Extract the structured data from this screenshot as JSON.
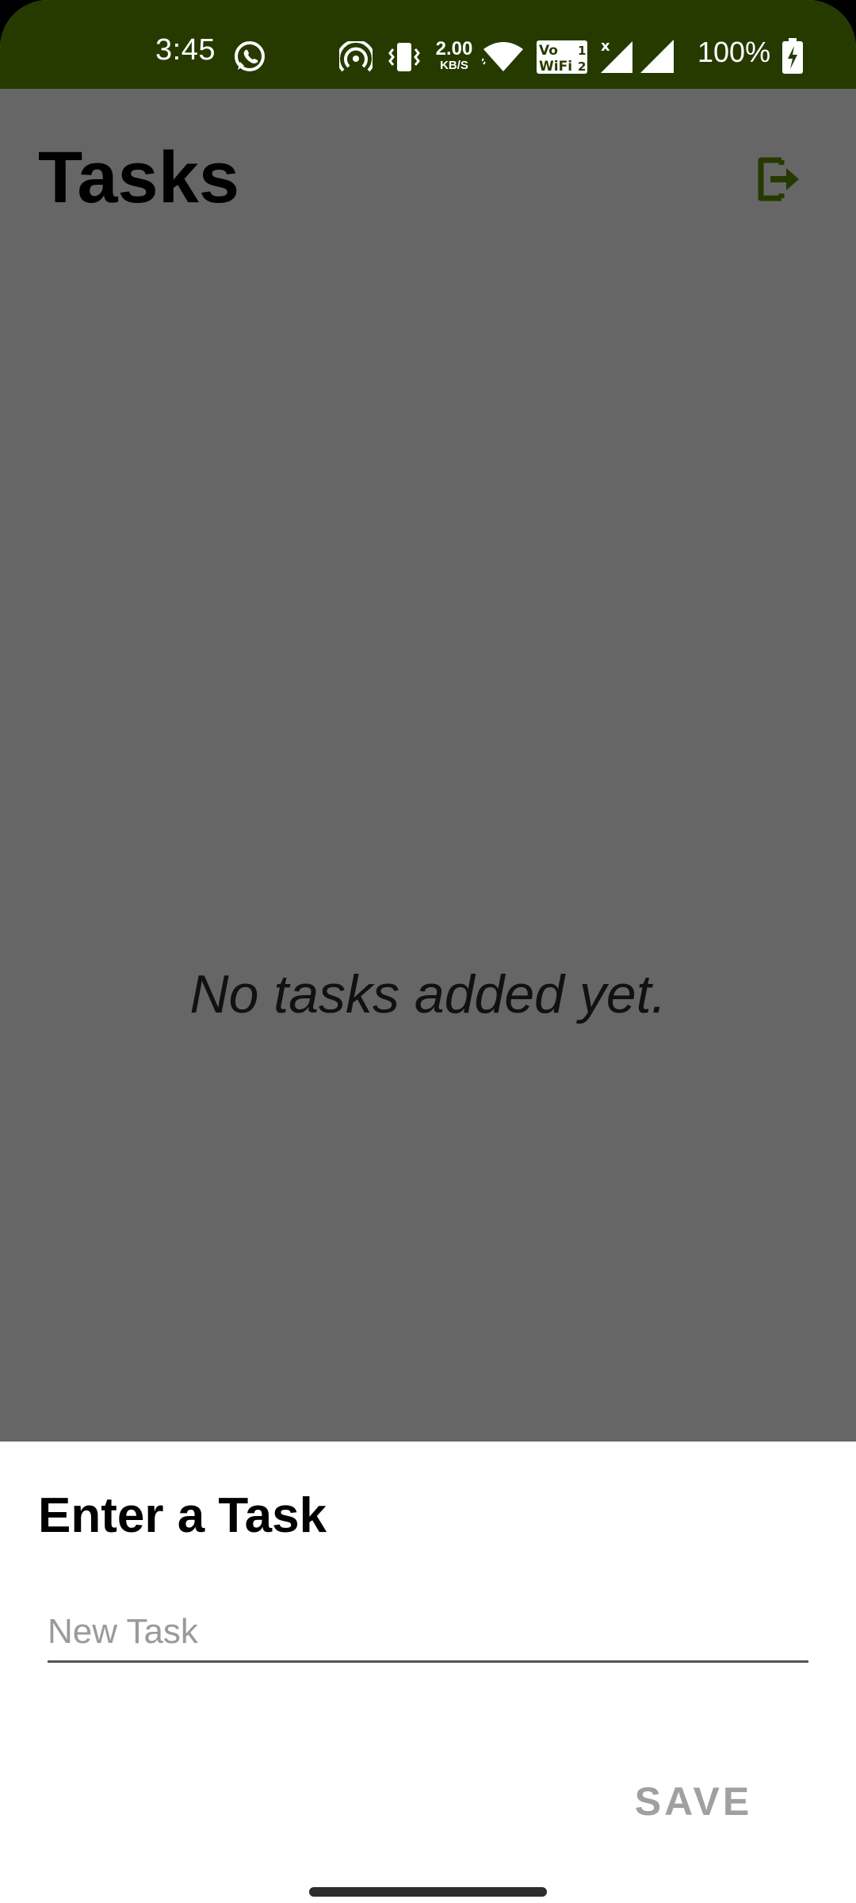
{
  "status_bar": {
    "time": "3:45",
    "net_speed_value": "2.00",
    "net_speed_unit": "KB/S",
    "battery_percent": "100%",
    "icons": [
      "whatsapp-icon",
      "hotspot-icon",
      "vibrate-icon",
      "wifi-icon",
      "vowifi-icon",
      "signal-icon",
      "signal-icon",
      "battery-charging-icon"
    ],
    "vowifi_top": "Vo",
    "vowifi_bottom": "WiFi",
    "sim1": "1",
    "sim2": "2",
    "no_signal_mark": "x"
  },
  "header": {
    "title": "Tasks",
    "logout_icon": "logout-icon"
  },
  "empty_state": {
    "message": "No tasks added yet."
  },
  "bottom_sheet": {
    "title": "Enter a Task",
    "input": {
      "value": "",
      "placeholder": "New Task"
    },
    "save_label": "SAVE"
  },
  "colors": {
    "status_bar_bg": "#263A00",
    "accent": "#263A00",
    "scrim_bg": "#666666",
    "sheet_bg": "#FFFFFF",
    "save_disabled": "#A0A0A0"
  }
}
